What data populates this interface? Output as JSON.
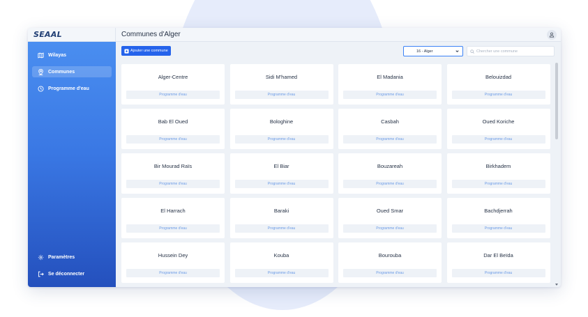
{
  "app": {
    "brand": "SEAAL",
    "page_title": "Communes d'Alger"
  },
  "sidebar": {
    "items": [
      {
        "label": "Wilayas",
        "icon": "map-icon",
        "active": false
      },
      {
        "label": "Communes",
        "icon": "location-pin-icon",
        "active": true
      },
      {
        "label": "Programme d'eau",
        "icon": "clock-icon",
        "active": false
      }
    ],
    "footer": [
      {
        "label": "Paramètres",
        "icon": "gear-icon"
      },
      {
        "label": "Se déconnecter",
        "icon": "logout-icon"
      }
    ]
  },
  "toolbar": {
    "add_label": "Ajouter une commune",
    "select_value": "16 - Alger",
    "search_placeholder": "Chercher une commune"
  },
  "communes": [
    {
      "name": "Alger-Centre",
      "action": "Programme d'eau"
    },
    {
      "name": "Sidi M'hamed",
      "action": "Programme d'eau"
    },
    {
      "name": "El Madania",
      "action": "Programme d'eau"
    },
    {
      "name": "Belouizdad",
      "action": "Programme d'eau"
    },
    {
      "name": "Bab El Oued",
      "action": "Programme d'eau"
    },
    {
      "name": "Bologhine",
      "action": "Programme d'eau"
    },
    {
      "name": "Casbah",
      "action": "Programme d'eau"
    },
    {
      "name": "Oued Koriche",
      "action": "Programme d'eau"
    },
    {
      "name": "Bir Mourad Raïs",
      "action": "Programme d'eau"
    },
    {
      "name": "El Biar",
      "action": "Programme d'eau"
    },
    {
      "name": "Bouzareah",
      "action": "Programme d'eau"
    },
    {
      "name": "Birkhadem",
      "action": "Programme d'eau"
    },
    {
      "name": "El Harrach",
      "action": "Programme d'eau"
    },
    {
      "name": "Baraki",
      "action": "Programme d'eau"
    },
    {
      "name": "Oued Smar",
      "action": "Programme d'eau"
    },
    {
      "name": "Bachdjerrah",
      "action": "Programme d'eau"
    },
    {
      "name": "Hussein Dey",
      "action": "Programme d'eau"
    },
    {
      "name": "Kouba",
      "action": "Programme d'eau"
    },
    {
      "name": "Bourouba",
      "action": "Programme d'eau"
    },
    {
      "name": "Dar El Beïda",
      "action": "Programme d'eau"
    }
  ],
  "colors": {
    "accent": "#2563eb",
    "sidebar_top": "#4a8ef0",
    "sidebar_bottom": "#2450bd",
    "link": "#6b9be6"
  }
}
